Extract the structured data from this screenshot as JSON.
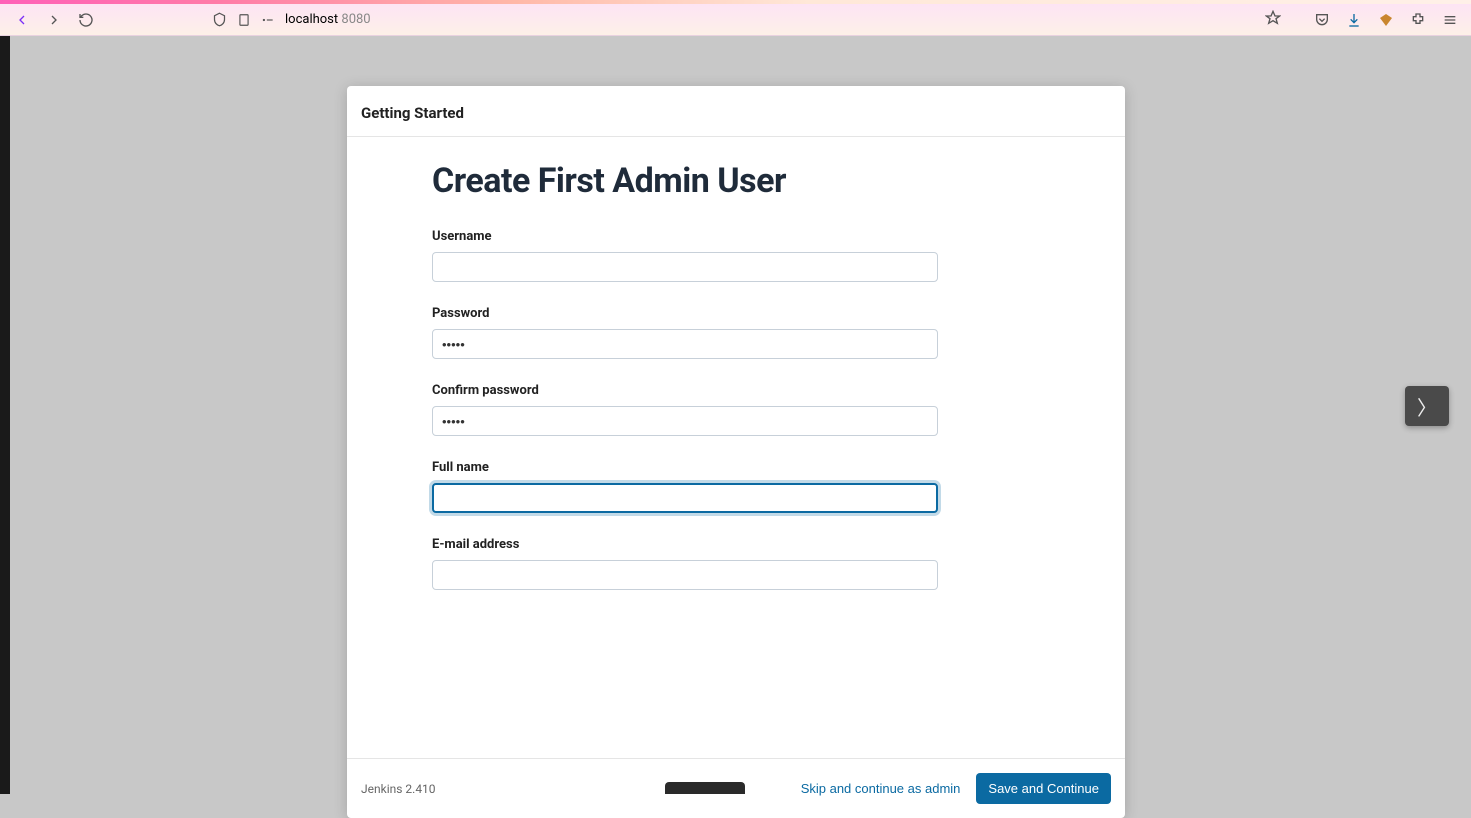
{
  "browser": {
    "url_host": "localhost",
    "url_port": "8080"
  },
  "modal": {
    "header_title": "Getting Started",
    "page_title": "Create First Admin User"
  },
  "form": {
    "username": {
      "label": "Username",
      "value": ""
    },
    "password": {
      "label": "Password",
      "value": "•••••"
    },
    "confirm_password": {
      "label": "Confirm password",
      "value": "•••••"
    },
    "full_name": {
      "label": "Full name",
      "value": ""
    },
    "email": {
      "label": "E-mail address",
      "value": ""
    }
  },
  "footer": {
    "version": "Jenkins 2.410",
    "skip_label": "Skip and continue as admin",
    "save_label": "Save and Continue"
  },
  "floating_next": "〉"
}
